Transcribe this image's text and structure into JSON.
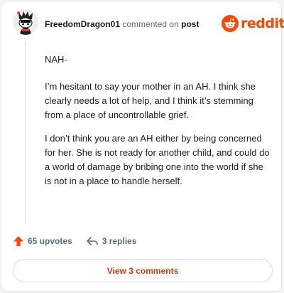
{
  "header": {
    "username": "FreedomDragon01",
    "action": "commented on",
    "target": "post",
    "brand": "reddit",
    "brand_color": "#ff4500"
  },
  "comment": {
    "paragraphs": [
      "NAH-",
      "I’m hesitant to say your mother in an AH. I think she clearly needs a lot of help, and I think it’s stemming from a place of uncontrollable grief.",
      "I don’t think you are an AH either by being concerned for her. She is not ready for another child, and could do a world of damage by bribing one into the world if she is not in a place to handle herself."
    ]
  },
  "footer": {
    "upvotes_label": "65 upvotes",
    "replies_label": "3 replies",
    "upvote_icon": "arrow-up-icon",
    "reply_icon": "reply-arrow-icon"
  },
  "view_button": {
    "label": "View 3 comments",
    "color": "#d93a00"
  }
}
